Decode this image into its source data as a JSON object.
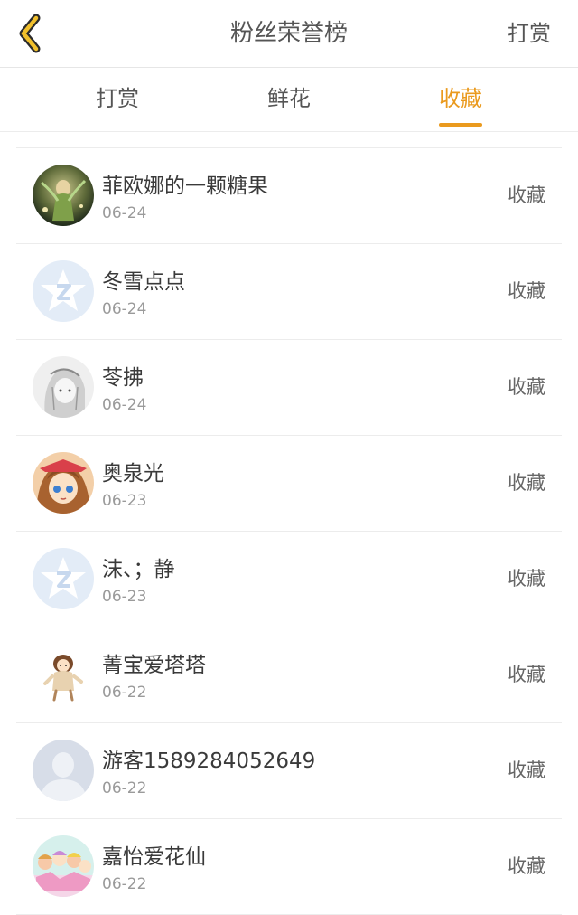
{
  "header": {
    "title": "粉丝荣誉榜",
    "action_label": "打赏",
    "back_icon": "chevron-left-icon",
    "accent_color": "#ea9a1e"
  },
  "tabs": [
    {
      "label": "打赏",
      "active": false
    },
    {
      "label": "鲜花",
      "active": false
    },
    {
      "label": "收藏",
      "active": true
    }
  ],
  "fans": [
    {
      "name": "菲欧娜的一颗糖果",
      "date": "06-24",
      "action": "收藏",
      "avatar": "fairy-avatar"
    },
    {
      "name": "冬雪点点",
      "date": "06-24",
      "action": "收藏",
      "avatar": "qq-star-default-avatar"
    },
    {
      "name": "苓拂",
      "date": "06-24",
      "action": "收藏",
      "avatar": "sketch-girl-avatar"
    },
    {
      "name": "奥泉光",
      "date": "06-23",
      "action": "收藏",
      "avatar": "anime-girl-avatar"
    },
    {
      "name": "沫、；静",
      "date": "06-23",
      "action": "收藏",
      "avatar": "qq-star-default-avatar"
    },
    {
      "name": "菁宝爱塔塔",
      "date": "06-22",
      "action": "收藏",
      "avatar": "chibi-girl-avatar"
    },
    {
      "name": "游客1589284052649",
      "date": "06-22",
      "action": "收藏",
      "avatar": "guest-silhouette-avatar"
    },
    {
      "name": "嘉怡爱花仙",
      "date": "06-22",
      "action": "收藏",
      "avatar": "group-anime-avatar"
    }
  ]
}
